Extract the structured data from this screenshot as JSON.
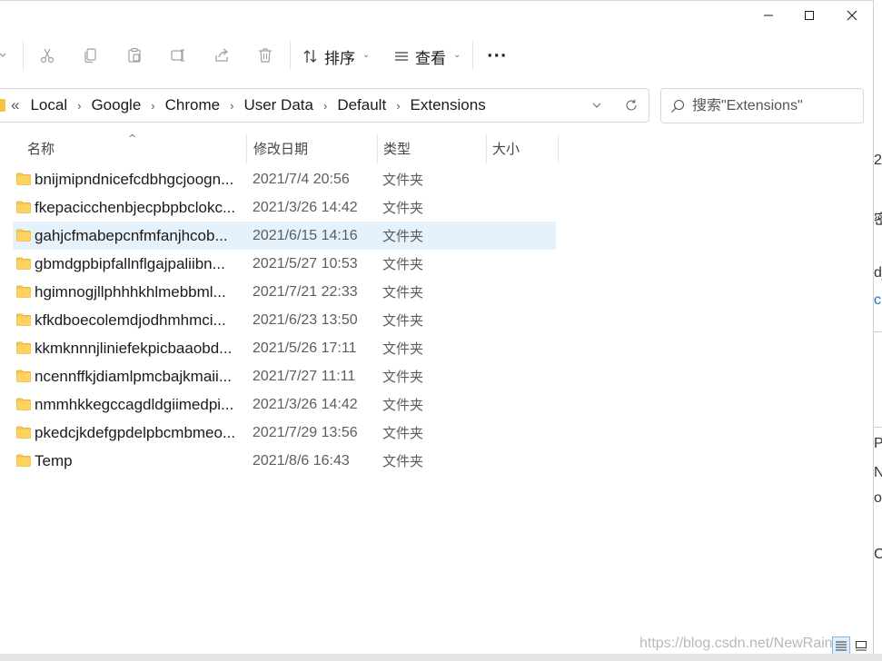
{
  "window": {
    "controls": {
      "minimize_icon": "minimize-icon",
      "maximize_icon": "maximize-icon",
      "close_icon": "close-icon"
    }
  },
  "toolbar": {
    "sort_label": "排序",
    "view_label": "查看",
    "more_label": "···"
  },
  "address": {
    "back_crumb": "«",
    "crumbs": [
      "Local",
      "Google",
      "Chrome",
      "User Data",
      "Default",
      "Extensions"
    ]
  },
  "search": {
    "placeholder": "搜索\"Extensions\""
  },
  "columns": {
    "name": "名称",
    "date": "修改日期",
    "type": "类型",
    "size": "大小"
  },
  "files": [
    {
      "name": "bnijmipndnicefcdbhgcjoogn...",
      "date": "2021/7/4 20:56",
      "type": "文件夹"
    },
    {
      "name": "fkepacicchenbjecpbpbclokc...",
      "date": "2021/3/26 14:42",
      "type": "文件夹"
    },
    {
      "name": "gahjcfmabepcnfmfanjhcob...",
      "date": "2021/6/15 14:16",
      "type": "文件夹",
      "selected": true
    },
    {
      "name": "gbmdgpbipfallnflgajpaliibn...",
      "date": "2021/5/27 10:53",
      "type": "文件夹"
    },
    {
      "name": "hgimnogjllphhhkhlmebbml...",
      "date": "2021/7/21 22:33",
      "type": "文件夹"
    },
    {
      "name": "kfkdboecolemdjodhmhmci...",
      "date": "2021/6/23 13:50",
      "type": "文件夹"
    },
    {
      "name": "kkmknnnjliniefekpicbaaobd...",
      "date": "2021/5/26 17:11",
      "type": "文件夹"
    },
    {
      "name": "ncennffkjdiamlpmcbajkmaii...",
      "date": "2021/7/27 11:11",
      "type": "文件夹"
    },
    {
      "name": "nmmhkkegccagdldgiimedpi...",
      "date": "2021/3/26 14:42",
      "type": "文件夹"
    },
    {
      "name": "pkedcjkdefgpdelpbcmbmeo...",
      "date": "2021/7/29 13:56",
      "type": "文件夹"
    },
    {
      "name": "Temp",
      "date": "2021/8/6 16:43",
      "type": "文件夹"
    }
  ],
  "watermark": "https://blog.csdn.net/NewRain",
  "background_fragments": [
    "2",
    "密",
    "dj",
    "c",
    "P",
    "N",
    "or",
    "C"
  ]
}
